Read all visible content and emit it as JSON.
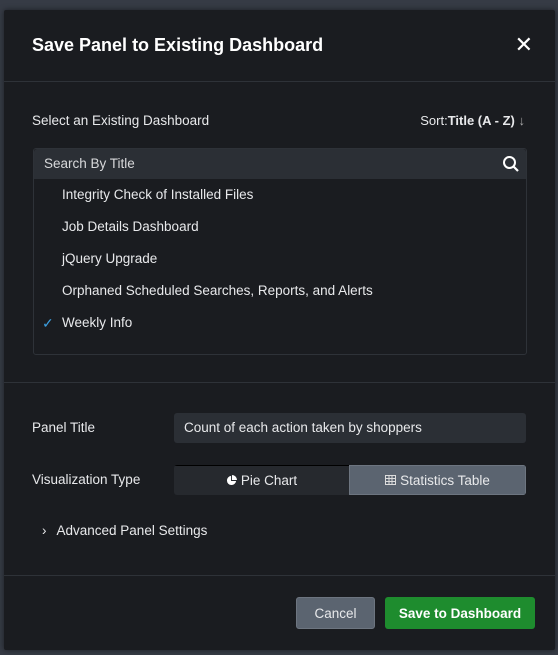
{
  "dialog": {
    "title": "Save Panel to Existing Dashboard"
  },
  "select": {
    "label": "Select an Existing Dashboard",
    "sort_prefix": "Sort:",
    "sort_value": "Title (A - Z)",
    "sort_arrow": "↓",
    "search_placeholder": "Search By Title",
    "items": [
      {
        "label": "Integrity Check of Installed Files",
        "selected": false
      },
      {
        "label": "Job Details Dashboard",
        "selected": false
      },
      {
        "label": "jQuery Upgrade",
        "selected": false
      },
      {
        "label": "Orphaned Scheduled Searches, Reports, and Alerts",
        "selected": false
      },
      {
        "label": "Weekly Info",
        "selected": true
      }
    ]
  },
  "panel_title": {
    "label": "Panel Title",
    "value": "Count of each action taken by shoppers"
  },
  "viz": {
    "label": "Visualization Type",
    "options": [
      "Pie Chart",
      "Statistics Table"
    ],
    "selected": "Statistics Table"
  },
  "advanced": {
    "label": "Advanced Panel Settings"
  },
  "footer": {
    "cancel": "Cancel",
    "save": "Save to Dashboard"
  },
  "colors": {
    "accent": "#1e8c2e",
    "check": "#3c9fe0"
  }
}
